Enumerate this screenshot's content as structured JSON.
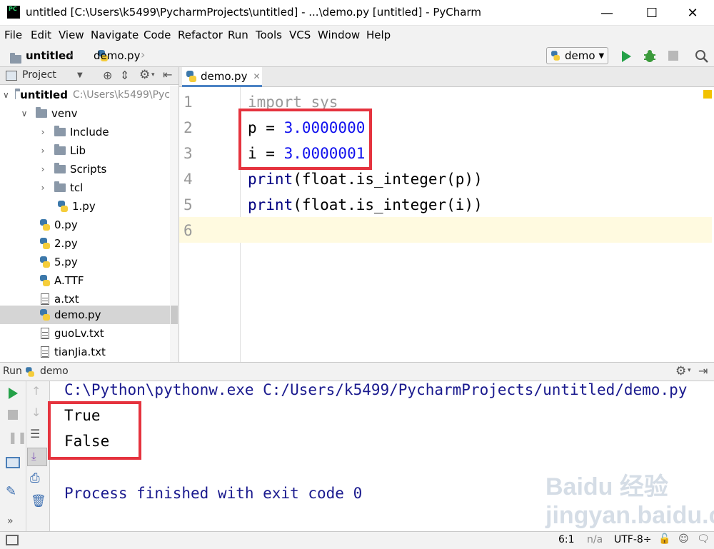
{
  "window": {
    "title": "untitled [C:\\Users\\k5499\\PycharmProjects\\untitled] - ...\\demo.py [untitled] - PyCharm",
    "logo_text": "PC"
  },
  "menu": [
    "File",
    "Edit",
    "View",
    "Navigate",
    "Code",
    "Refactor",
    "Run",
    "Tools",
    "VCS",
    "Window",
    "Help"
  ],
  "breadcrumb": {
    "project": "untitled",
    "file": "demo.py"
  },
  "run_config": "demo",
  "project_panel": {
    "title": "Project",
    "root": {
      "name": "untitled",
      "path": "C:\\Users\\k5499\\Pyc"
    },
    "items": [
      {
        "name": "venv",
        "type": "folder"
      },
      {
        "name": "Include",
        "type": "folder"
      },
      {
        "name": "Lib",
        "type": "folder"
      },
      {
        "name": "Scripts",
        "type": "folder"
      },
      {
        "name": "tcl",
        "type": "folder"
      },
      {
        "name": "1.py",
        "type": "py"
      },
      {
        "name": "0.py",
        "type": "py"
      },
      {
        "name": "2.py",
        "type": "py"
      },
      {
        "name": "5.py",
        "type": "py"
      },
      {
        "name": "A.TTF",
        "type": "py"
      },
      {
        "name": "a.txt",
        "type": "txt"
      },
      {
        "name": "demo.py",
        "type": "py",
        "selected": true
      },
      {
        "name": "guoLv.txt",
        "type": "txt"
      },
      {
        "name": "tianJia.txt",
        "type": "txt"
      }
    ]
  },
  "editor": {
    "tab": "demo.py",
    "line_numbers": [
      "1",
      "2",
      "3",
      "4",
      "5",
      "6"
    ],
    "lines": {
      "l1": "import sys",
      "l2_var": "p = ",
      "l2_val": "3.0000000",
      "l3_var": "i = ",
      "l3_val": "3.0000001",
      "l4_fn": "print",
      "l4_rest": "(float.is_integer(p))",
      "l5_fn": "print",
      "l5_rest": "(float.is_integer(i))"
    }
  },
  "run_panel": {
    "label": "Run",
    "config": "demo",
    "command": "C:\\Python\\pythonw.exe C:/Users/k5499/PycharmProjects/untitled/demo.py",
    "output": [
      "True",
      "False"
    ],
    "finished": "Process finished with exit code 0"
  },
  "status_bar": {
    "position": "6:1",
    "line_sep": "n/a",
    "encoding": "UTF-8÷"
  },
  "watermark": "Baidu 经验 jingyan.baidu.com"
}
